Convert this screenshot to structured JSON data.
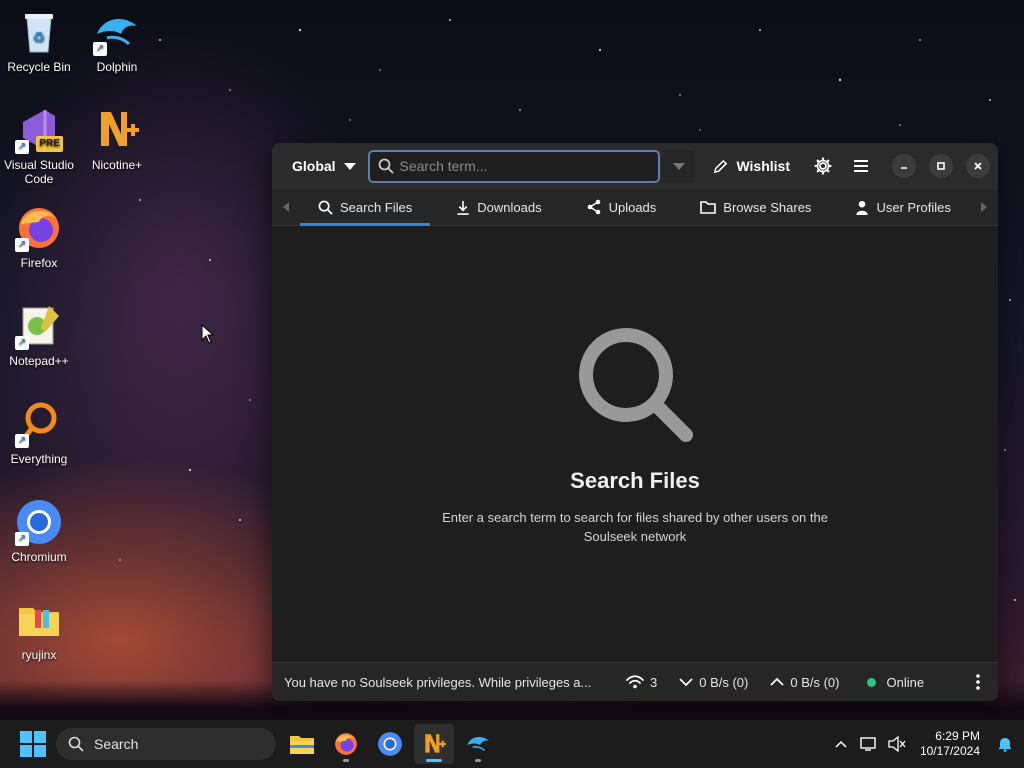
{
  "desktop": {
    "icons": [
      {
        "label": "Recycle Bin",
        "icon": "recycle-bin-icon"
      },
      {
        "label": "Dolphin",
        "icon": "dolphin-icon"
      },
      {
        "label": "Visual Studio Code",
        "icon": "vscode-icon",
        "badge": "PRE"
      },
      {
        "label": "Nicotine+",
        "icon": "nicotine-icon"
      },
      {
        "label": "Firefox",
        "icon": "firefox-icon"
      },
      {
        "label": "Notepad++",
        "icon": "notepadpp-icon"
      },
      {
        "label": "Everything",
        "icon": "everything-icon"
      },
      {
        "label": "Chromium",
        "icon": "chromium-icon"
      },
      {
        "label": "ryujinx",
        "icon": "folder-icon"
      }
    ]
  },
  "app": {
    "search_mode": "Global",
    "search_placeholder": "Search term...",
    "wishlist_label": "Wishlist",
    "tabs": [
      {
        "label": "Search Files",
        "icon": "search-icon",
        "active": true
      },
      {
        "label": "Downloads",
        "icon": "download-icon",
        "active": false
      },
      {
        "label": "Uploads",
        "icon": "share-icon",
        "active": false
      },
      {
        "label": "Browse Shares",
        "icon": "folder-icon",
        "active": false
      },
      {
        "label": "User Profiles",
        "icon": "user-icon",
        "active": false
      }
    ],
    "empty_state": {
      "title": "Search Files",
      "description": "Enter a search term to search for files shared by other users on the Soulseek network"
    },
    "status": {
      "message": "You have no Soulseek privileges. While privileges a...",
      "connections": "3",
      "download_speed": "0 B/s (0)",
      "upload_speed": "0 B/s (0)",
      "online_label": "Online"
    },
    "colors": {
      "accent": "#3584e4",
      "online": "#2ec27e"
    }
  },
  "taskbar": {
    "search_label": "Search",
    "apps": [
      "file-explorer-icon",
      "firefox-icon",
      "chromium-icon",
      "nicotine-icon",
      "dolphin-icon"
    ],
    "time": "6:29 PM",
    "date": "10/17/2024"
  }
}
